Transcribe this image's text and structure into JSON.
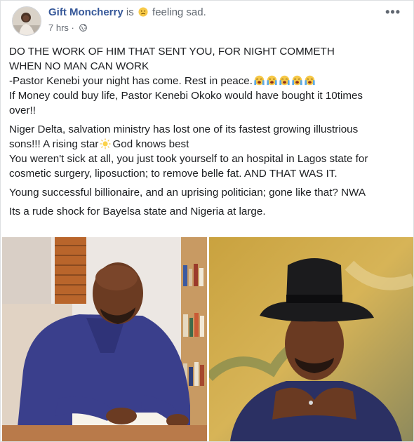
{
  "post": {
    "author": "Gift Moncherry",
    "status_prefix": "is",
    "feeling": "feeling sad.",
    "feeling_icon": "sad-face-emoji",
    "time": "7 hrs",
    "audience_icon": "globe-icon",
    "more_icon": "•••",
    "paragraphs": [
      {
        "lines": [
          "DO THE WORK OF HIM THAT SENT YOU, FOR NIGHT COMMETH",
          "WHEN NO MAN CAN WORK",
          "-Pastor Kenebi your night has come. Rest in peace.",
          "If Money could buy life, Pastor Kenebi Okoko would have bought it 10times",
          "over!!"
        ]
      },
      {
        "lines": [
          "Niger Delta, salvation ministry has lost one of its fastest growing illustrious",
          "sons!!! A rising star",
          "God knows best",
          "You weren't sick at all, you just took yourself to an hospital in Lagos state for",
          "cosmetic surgery, liposuction; to remove belle fat. AND THAT WAS IT."
        ]
      },
      {
        "lines": [
          "Young successful billionaire, and an uprising politician; gone like that? NWA"
        ]
      },
      {
        "lines": [
          "Its a rude shock for Bayelsa state and Nigeria at large."
        ]
      }
    ],
    "crying_emoji_count": 5,
    "photos": [
      {
        "subject": "man-signing-document-photo"
      },
      {
        "subject": "man-in-black-hat-photo"
      }
    ],
    "colors": {
      "author": "#365899",
      "text": "#1c1e21",
      "meta": "#616770",
      "border": "#dddfe2"
    }
  }
}
